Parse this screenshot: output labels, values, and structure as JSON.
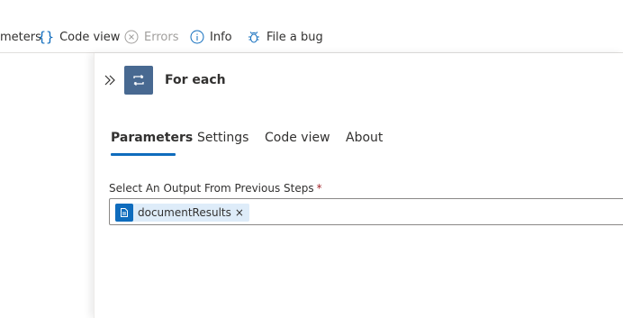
{
  "toolbar": {
    "items": [
      {
        "label": "meters",
        "icon": "sliders-icon",
        "disabled": false
      },
      {
        "label": "Code view",
        "icon": "braces-icon",
        "disabled": false
      },
      {
        "label": "Errors",
        "icon": "error-circle-icon",
        "disabled": true
      },
      {
        "label": "Info",
        "icon": "info-icon",
        "disabled": false
      },
      {
        "label": "File a bug",
        "icon": "bug-icon",
        "disabled": false
      }
    ]
  },
  "panel": {
    "title": "For each",
    "action_icon": "loop-icon",
    "action_icon_color": "#486991",
    "tabs": [
      {
        "label": "Parameters",
        "active": true
      },
      {
        "label": "Settings",
        "active": false
      },
      {
        "label": "Code view",
        "active": false
      },
      {
        "label": "About",
        "active": false
      }
    ],
    "field": {
      "label": "Select An Output From Previous Steps",
      "required_mark": "*",
      "token": {
        "label": "documentResults",
        "icon": "document-icon",
        "remove": "×"
      }
    }
  },
  "colors": {
    "accent": "#0f6cbd",
    "token_bg": "#deecf9",
    "required": "#a4262c"
  }
}
